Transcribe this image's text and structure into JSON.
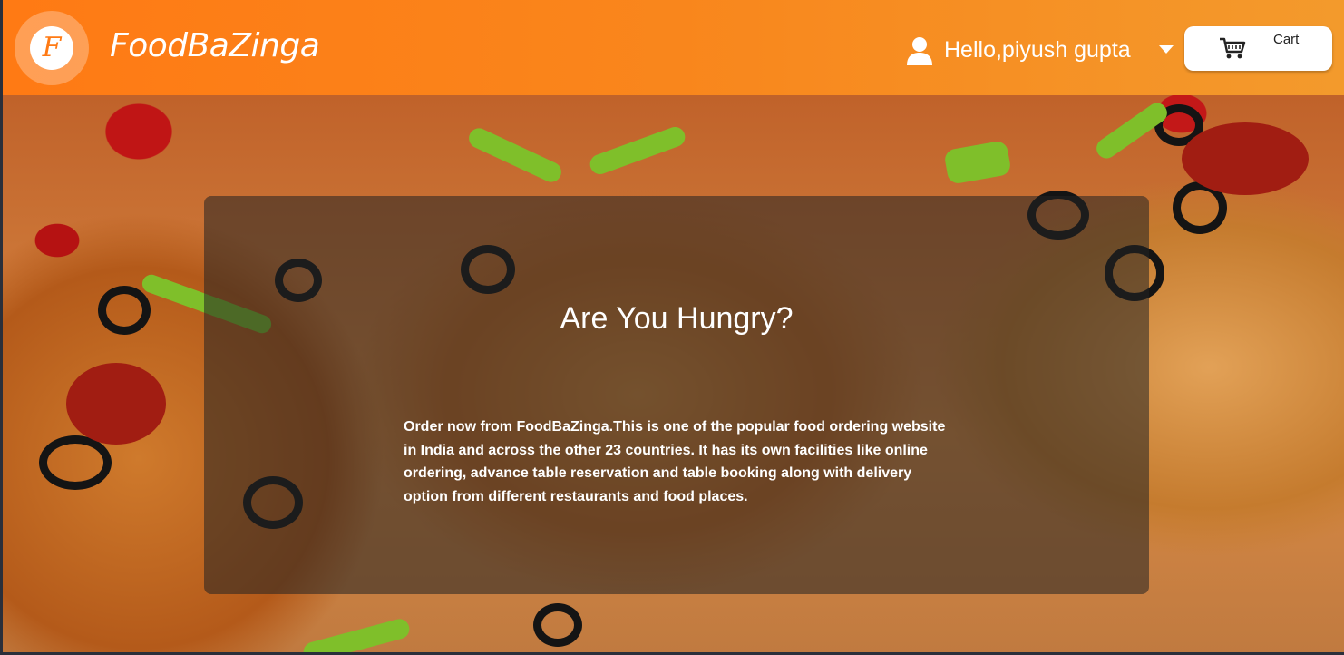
{
  "header": {
    "logo_letter": "F",
    "brand": "FoodBaZinga",
    "user_greeting": "Hello,piyush gupta",
    "cart_label": "Cart"
  },
  "hero": {
    "title": "Are You Hungry?",
    "description": "Order now from FoodBaZinga.This is one of the popular food ordering website in India and across the other 23 countries. It has its own facilities like online ordering, advance table reservation and table booking along with delivery option from different restaurants and food places."
  },
  "colors": {
    "header_start": "#ff7a14",
    "header_end": "#f39a2c",
    "overlay": "rgba(35,35,35,0.55)"
  },
  "icons": {
    "user": "user-icon",
    "caret": "caret-down-icon",
    "cart": "cart-icon"
  }
}
